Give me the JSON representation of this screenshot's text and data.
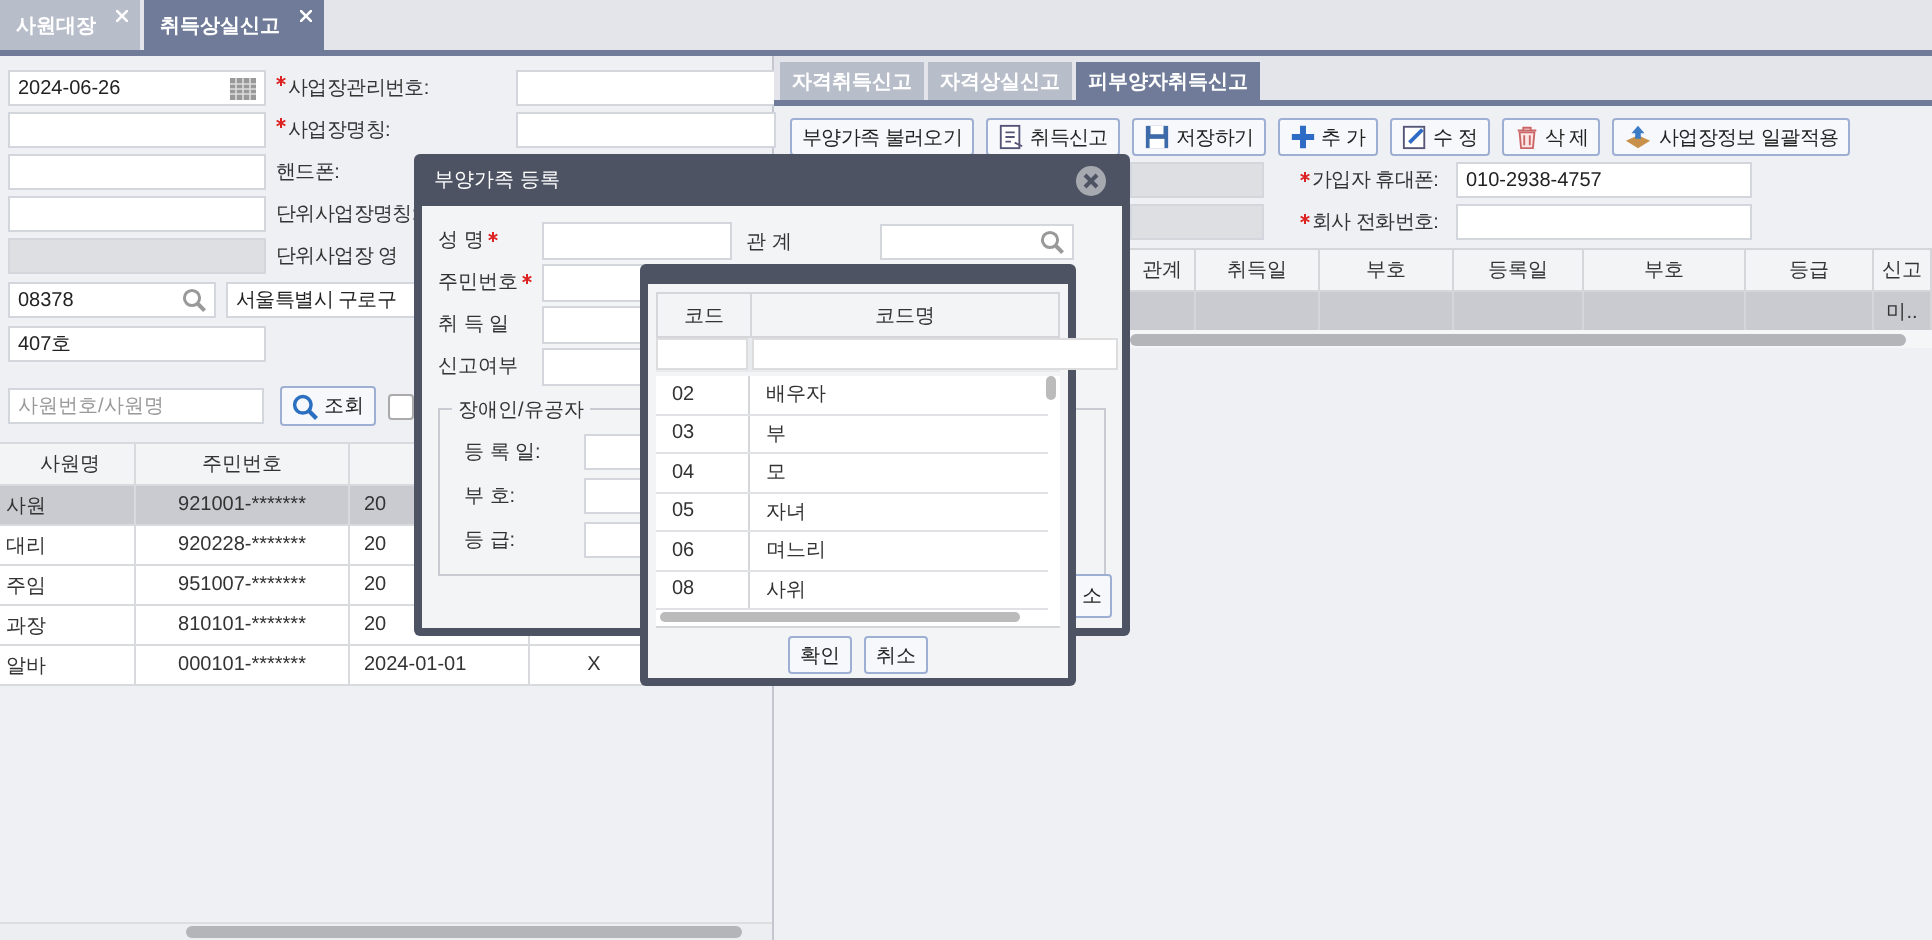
{
  "tabs": [
    {
      "label": "사원대장",
      "selected": false
    },
    {
      "label": "취득상실신고",
      "selected": true
    }
  ],
  "left_form": {
    "rows": [
      {
        "input": {
          "kind": "date",
          "value": "2024-06-26"
        },
        "label": "사업장관리번호:",
        "required": true
      },
      {
        "input": {
          "kind": "text"
        },
        "label": "사업장명칭:",
        "required": true
      },
      {
        "input": {
          "kind": "text"
        },
        "label": "핸드폰:",
        "required": false
      },
      {
        "input": {
          "kind": "text"
        },
        "label": "단위사업장명칭:",
        "required": false
      },
      {
        "input": {
          "kind": "disabled"
        },
        "label": "단위사업장 영",
        "required": false
      }
    ],
    "zip": "08378",
    "address": "서울특별시 구로구",
    "address_detail": "407호"
  },
  "search": {
    "placeholder": "사원번호/사원명",
    "button": "조회",
    "checked": false
  },
  "employees": {
    "columns": [
      "사원명",
      "주민번호"
    ],
    "rows": [
      {
        "cells": [
          "사원",
          "921001-*******",
          "20"
        ],
        "selected": true
      },
      {
        "cells": [
          "대리",
          "920228-*******",
          "20"
        ],
        "selected": false
      },
      {
        "cells": [
          "주임",
          "951007-*******",
          "20"
        ],
        "selected": false
      },
      {
        "cells": [
          "과장",
          "810101-*******",
          "20"
        ],
        "selected": false
      },
      {
        "cells": [
          "알바",
          "000101-*******",
          "2024-01-01",
          "X"
        ],
        "selected": false
      }
    ]
  },
  "subtabs": [
    {
      "label": "자격취득신고",
      "selected": false
    },
    {
      "label": "자격상실신고",
      "selected": false
    },
    {
      "label": "피부양자취득신고",
      "selected": true
    }
  ],
  "toolbar": [
    {
      "label": "부양가족 불러오기"
    },
    {
      "label": "취득신고"
    },
    {
      "label": "저장하기"
    },
    {
      "label": "추 가"
    },
    {
      "label": "수 정"
    },
    {
      "label": "삭 제"
    },
    {
      "label": "사업장정보 일괄적용"
    }
  ],
  "contact": [
    {
      "label": "가입자 휴대폰:",
      "required": true,
      "value": "010-2938-4757"
    },
    {
      "label": "회사 전화번호:",
      "required": true
    }
  ],
  "grid": {
    "columns": [
      "관계",
      "취득일",
      "부호",
      "등록일",
      "부호",
      "등급",
      "신고"
    ],
    "rows": [
      {
        "selected": true,
        "column_7": "미.."
      }
    ]
  },
  "dialog": {
    "title": "부양가족 등록",
    "fields": [
      {
        "label": "성 명",
        "required": true
      },
      {
        "label": "주민번호",
        "required": true
      },
      {
        "label": "취 득 일",
        "required": false
      },
      {
        "label": "신고여부",
        "required": false
      }
    ],
    "relation_label": "관 계",
    "group": {
      "legend": "장애인/유공자",
      "fields": [
        "등 록 일:",
        "부 호:",
        "등 급:"
      ]
    },
    "button_fragment": "소"
  },
  "popup": {
    "columns": [
      "코드",
      "코드명"
    ],
    "rows": [
      {
        "code": "02",
        "name": "배우자"
      },
      {
        "code": "03",
        "name": "부"
      },
      {
        "code": "04",
        "name": "모"
      },
      {
        "code": "05",
        "name": "자녀"
      },
      {
        "code": "06",
        "name": "며느리"
      },
      {
        "code": "08",
        "name": "사위"
      }
    ],
    "buttons": [
      "확인",
      "취소"
    ]
  }
}
